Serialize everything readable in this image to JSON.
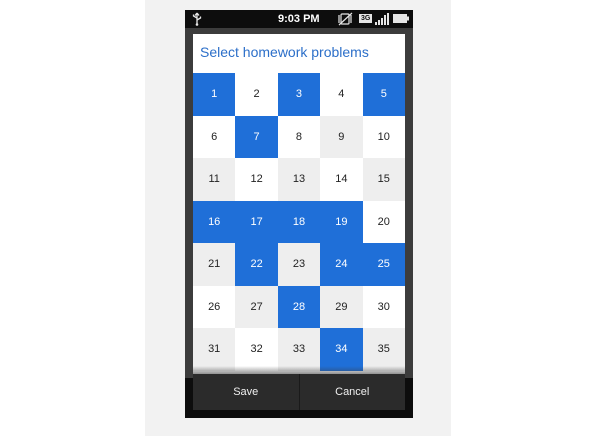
{
  "status_bar": {
    "time": "9:03 PM",
    "network": "3G",
    "icons": [
      "usb-icon",
      "silent-mode-icon",
      "network-3g-icon",
      "signal-icon",
      "battery-icon"
    ]
  },
  "dialog": {
    "title": "Select homework problems",
    "problems": [
      {
        "label": "1",
        "selected": true
      },
      {
        "label": "2",
        "selected": false
      },
      {
        "label": "3",
        "selected": true
      },
      {
        "label": "4",
        "selected": false
      },
      {
        "label": "5",
        "selected": true
      },
      {
        "label": "6",
        "selected": false
      },
      {
        "label": "7",
        "selected": true
      },
      {
        "label": "8",
        "selected": false
      },
      {
        "label": "9",
        "selected": false
      },
      {
        "label": "10",
        "selected": false
      },
      {
        "label": "11",
        "selected": false
      },
      {
        "label": "12",
        "selected": false
      },
      {
        "label": "13",
        "selected": false
      },
      {
        "label": "14",
        "selected": false
      },
      {
        "label": "15",
        "selected": false
      },
      {
        "label": "16",
        "selected": true
      },
      {
        "label": "17",
        "selected": true
      },
      {
        "label": "18",
        "selected": true
      },
      {
        "label": "19",
        "selected": true
      },
      {
        "label": "20",
        "selected": false
      },
      {
        "label": "21",
        "selected": false
      },
      {
        "label": "22",
        "selected": true
      },
      {
        "label": "23",
        "selected": false
      },
      {
        "label": "24",
        "selected": true
      },
      {
        "label": "25",
        "selected": true
      },
      {
        "label": "26",
        "selected": false
      },
      {
        "label": "27",
        "selected": false
      },
      {
        "label": "28",
        "selected": true
      },
      {
        "label": "29",
        "selected": false
      },
      {
        "label": "30",
        "selected": false
      },
      {
        "label": "31",
        "selected": false
      },
      {
        "label": "32",
        "selected": false
      },
      {
        "label": "33",
        "selected": false
      },
      {
        "label": "34",
        "selected": true
      },
      {
        "label": "35",
        "selected": false
      }
    ],
    "buttons": {
      "save_label": "Save",
      "cancel_label": "Cancel"
    }
  },
  "colors": {
    "selected": "#1f6fd8",
    "title": "#2c6fc9",
    "cell_grey": "#eeeeee",
    "cell_white": "#ffffff",
    "button_bar": "#2b2b2b"
  }
}
